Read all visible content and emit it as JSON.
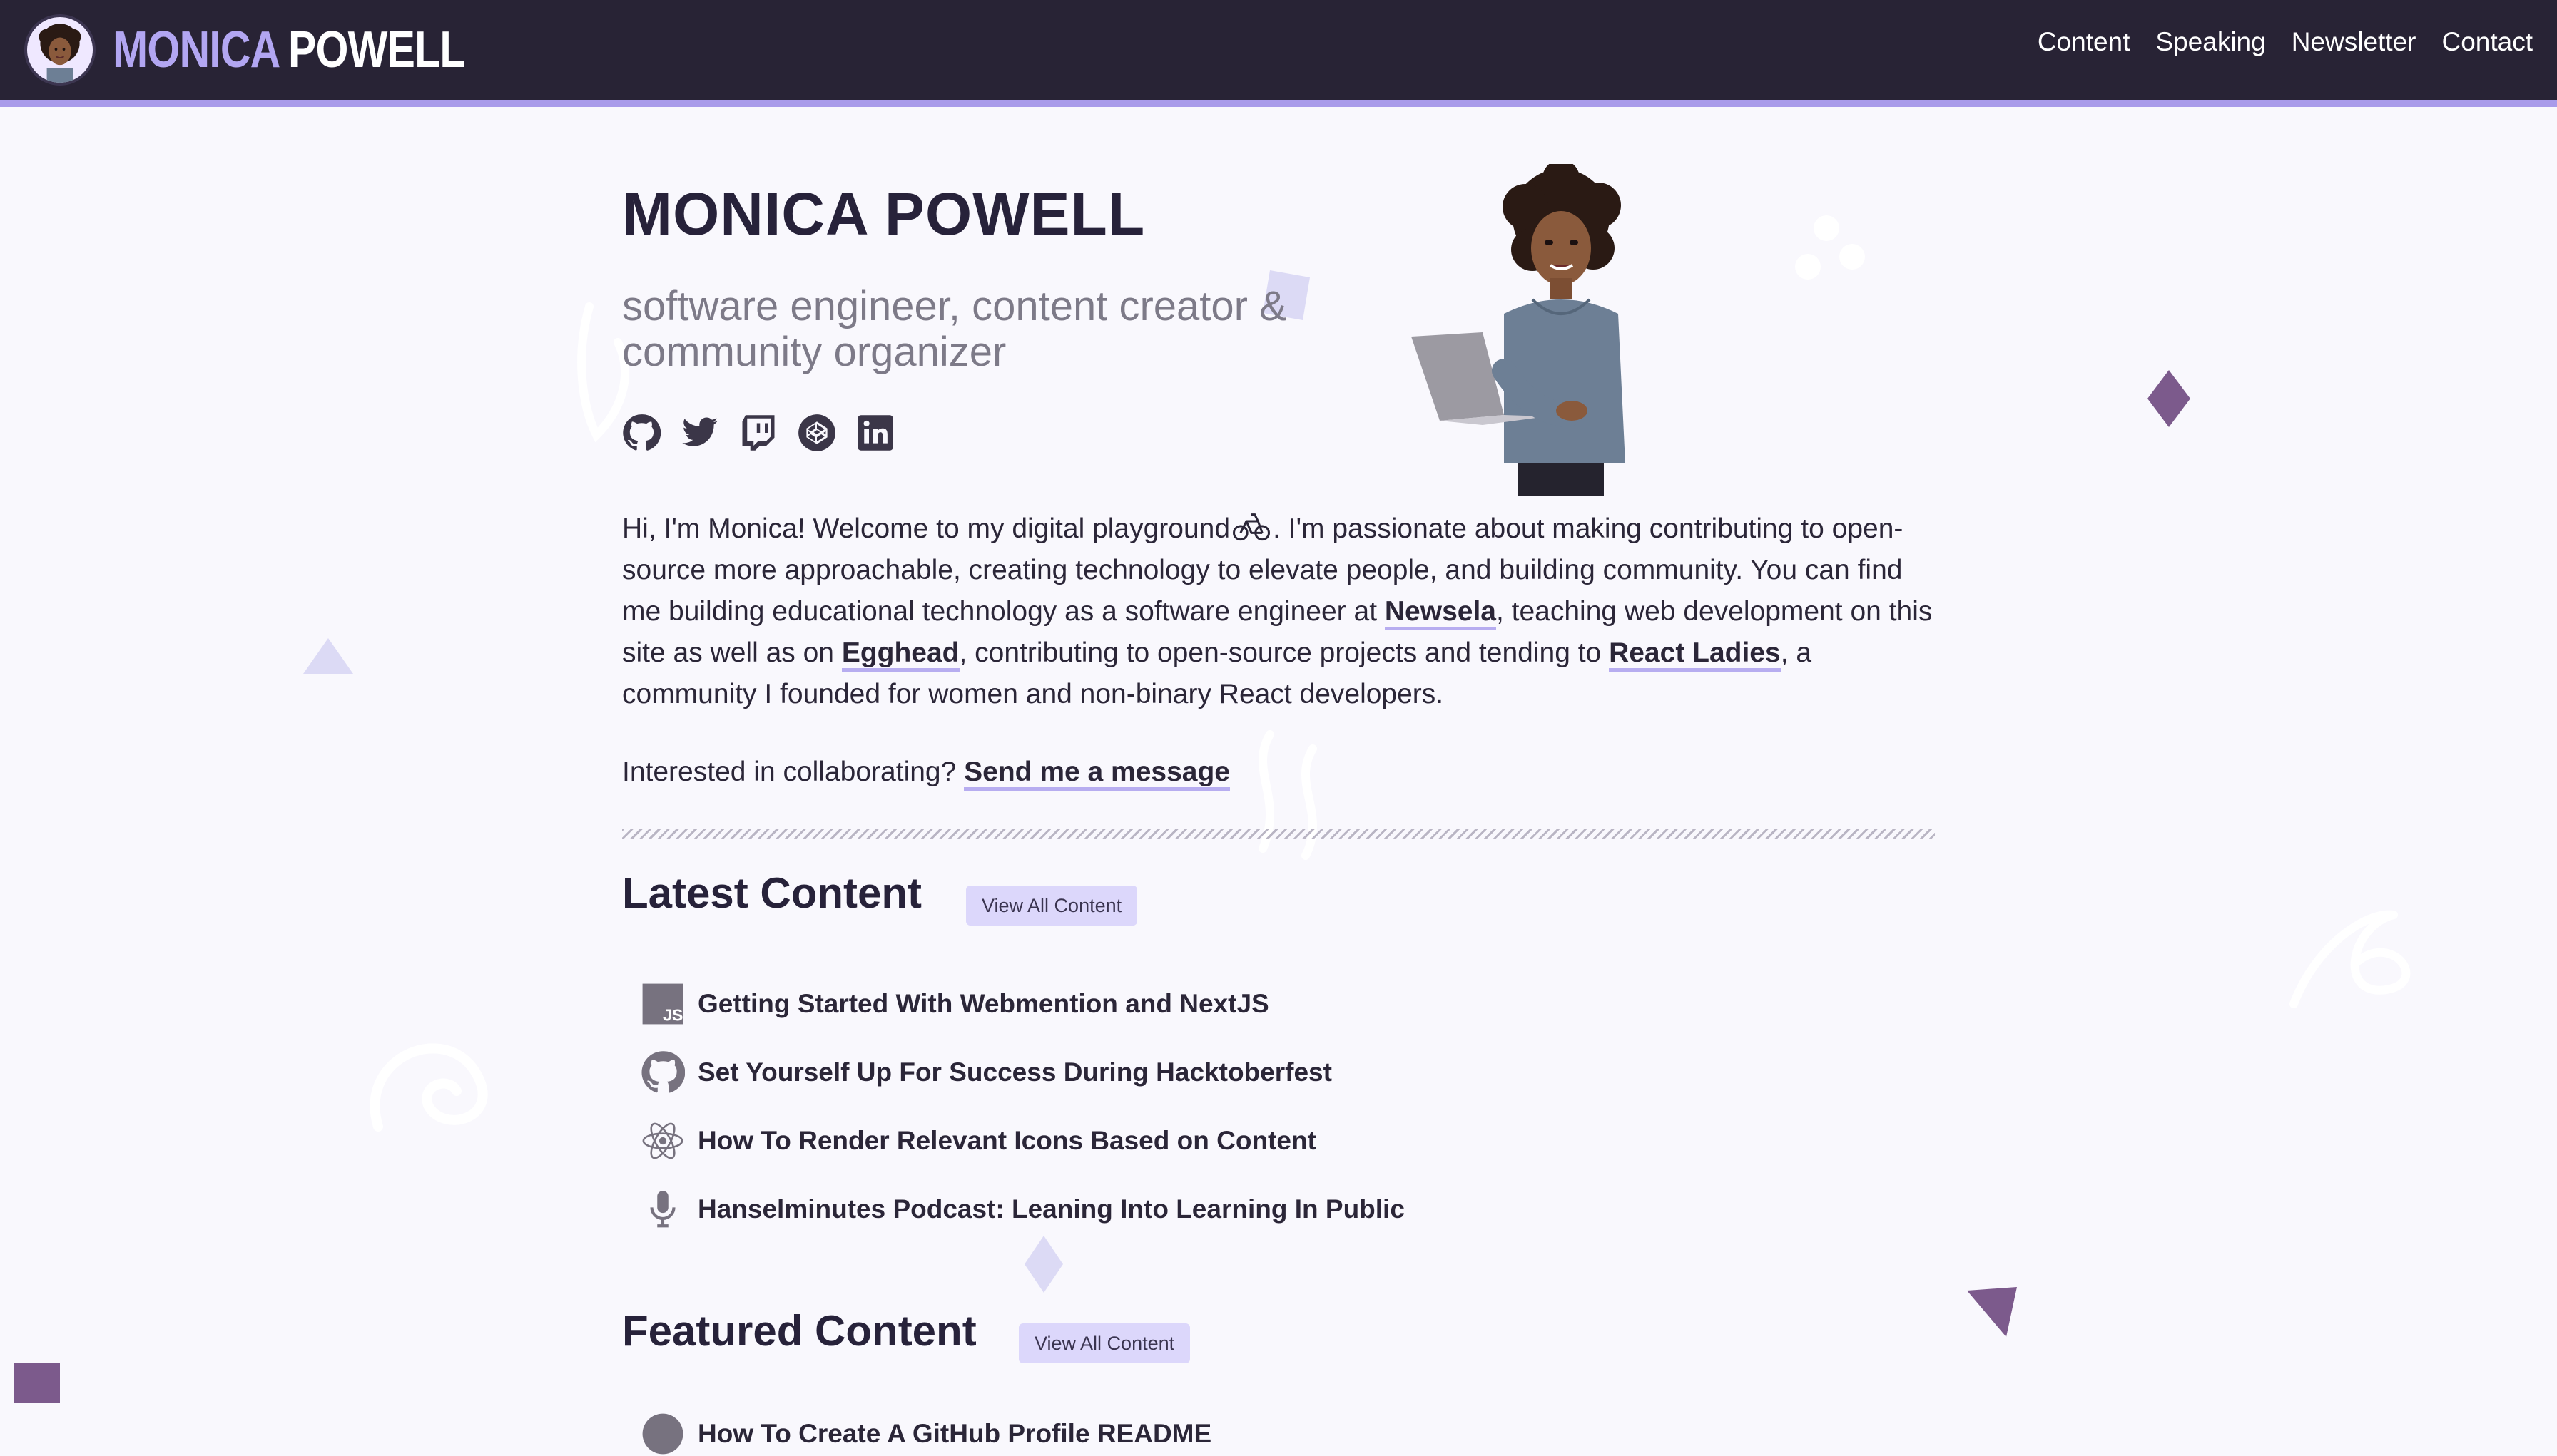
{
  "header": {
    "brand_first": "MONICA",
    "brand_last": "POWELL",
    "nav": [
      "Content",
      "Speaking",
      "Newsletter",
      "Contact"
    ]
  },
  "hero": {
    "title": "MONICA POWELL",
    "subtitle": "software engineer, content creator & community organizer",
    "social_icons": [
      "github-icon",
      "twitter-icon",
      "twitch-icon",
      "codepen-icon",
      "linkedin-icon"
    ]
  },
  "intro": {
    "part1": "Hi, I'm Monica! Welcome to my digital playground",
    "part2": ". I'm passionate about making contributing to open-source more approachable, creating technology to elevate people, and building community. You can find me building educational technology as a software engineer at ",
    "link_newsela": "Newsela",
    "part3": ", teaching web development on this site as well as on ",
    "link_egghead": "Egghead",
    "part4": ", contributing to open-source projects and tending to ",
    "link_react_ladies": "React Ladies",
    "part5": ", a community I founded for women and non-binary React developers."
  },
  "collab": {
    "text": "Interested in collaborating? ",
    "link": "Send me a message"
  },
  "latest": {
    "title": "Latest Content",
    "button": "View All Content",
    "items": [
      {
        "icon": "javascript-icon",
        "title": "Getting Started With Webmention and NextJS"
      },
      {
        "icon": "github-icon",
        "title": "Set Yourself Up For Success During Hacktoberfest"
      },
      {
        "icon": "react-icon",
        "title": "How To Render Relevant Icons Based on Content"
      },
      {
        "icon": "microphone-icon",
        "title": "Hanselminutes Podcast: Leaning Into Learning In Public"
      }
    ]
  },
  "featured": {
    "title": "Featured Content",
    "button": "View All Content",
    "first_item": "How To Create A GitHub Profile README"
  },
  "colors": {
    "header_bg": "#282335",
    "accent": "#a99bea",
    "page_bg": "#f9f8fd",
    "button_bg": "#dcd7fb"
  }
}
